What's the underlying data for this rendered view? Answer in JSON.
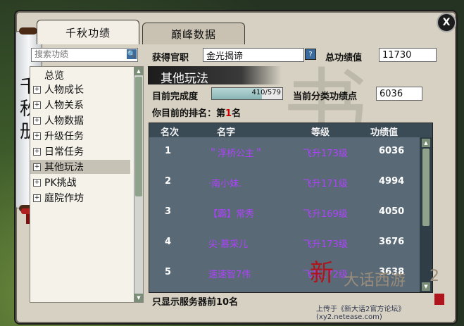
{
  "window": {
    "side_title": "千秋册",
    "close_label": "X"
  },
  "tabs": [
    {
      "label": "千秋功绩"
    },
    {
      "label": "巅峰数据"
    }
  ],
  "search": {
    "placeholder": "搜索功绩",
    "icon": "search-icon"
  },
  "nav": [
    {
      "label": "总览",
      "expandable": false
    },
    {
      "label": "人物成长",
      "expandable": true
    },
    {
      "label": "人物关系",
      "expandable": true
    },
    {
      "label": "人物数据",
      "expandable": true
    },
    {
      "label": "升级任务",
      "expandable": true
    },
    {
      "label": "日常任务",
      "expandable": true
    },
    {
      "label": "其他玩法",
      "expandable": true,
      "selected": true
    },
    {
      "label": "PK挑战",
      "expandable": true
    },
    {
      "label": "庭院作坊",
      "expandable": true
    }
  ],
  "header": {
    "title_label": "获得官职",
    "title_value": "金光揭谛",
    "help": "?",
    "total_label": "总功绩值",
    "total_value": "11730"
  },
  "section": {
    "title": "其他玩法",
    "completion_label": "目前完成度",
    "completion_text": "410/579",
    "completion_current": 410,
    "completion_max": 579,
    "category_points_label": "当前分类功绩点",
    "category_points_value": "6036",
    "rank_prefix": "你目前的排名：第",
    "rank_value": "1",
    "rank_suffix": "名"
  },
  "table": {
    "columns": [
      "名次",
      "名字",
      "等级",
      "功绩值"
    ],
    "rows": [
      {
        "rank": "1",
        "name": "＂浮桥公主＂",
        "level": "飞升173级",
        "score": "6036"
      },
      {
        "rank": "2",
        "name": "·南小妹.",
        "level": "飞升171级",
        "score": "4994"
      },
      {
        "rank": "3",
        "name": "【霸】常秀",
        "level": "飞升169级",
        "score": "4050"
      },
      {
        "rank": "4",
        "name": "尖·慕采儿",
        "level": "飞升173级",
        "score": "3676"
      },
      {
        "rank": "5",
        "name": "速速智7伟",
        "level": "飞升172级",
        "score": "3638"
      }
    ]
  },
  "footer_note": "只显示服务器前10名",
  "branding": {
    "logo_main": "新",
    "logo_sub": "大话西游",
    "logo_num": "2",
    "watermark": "上传于《新大话2官方论坛》(xy2.netease.com)"
  },
  "colors": {
    "rank_highlight": "#d10000",
    "player_name": "#b040ff",
    "table_bg": "#596a76"
  }
}
